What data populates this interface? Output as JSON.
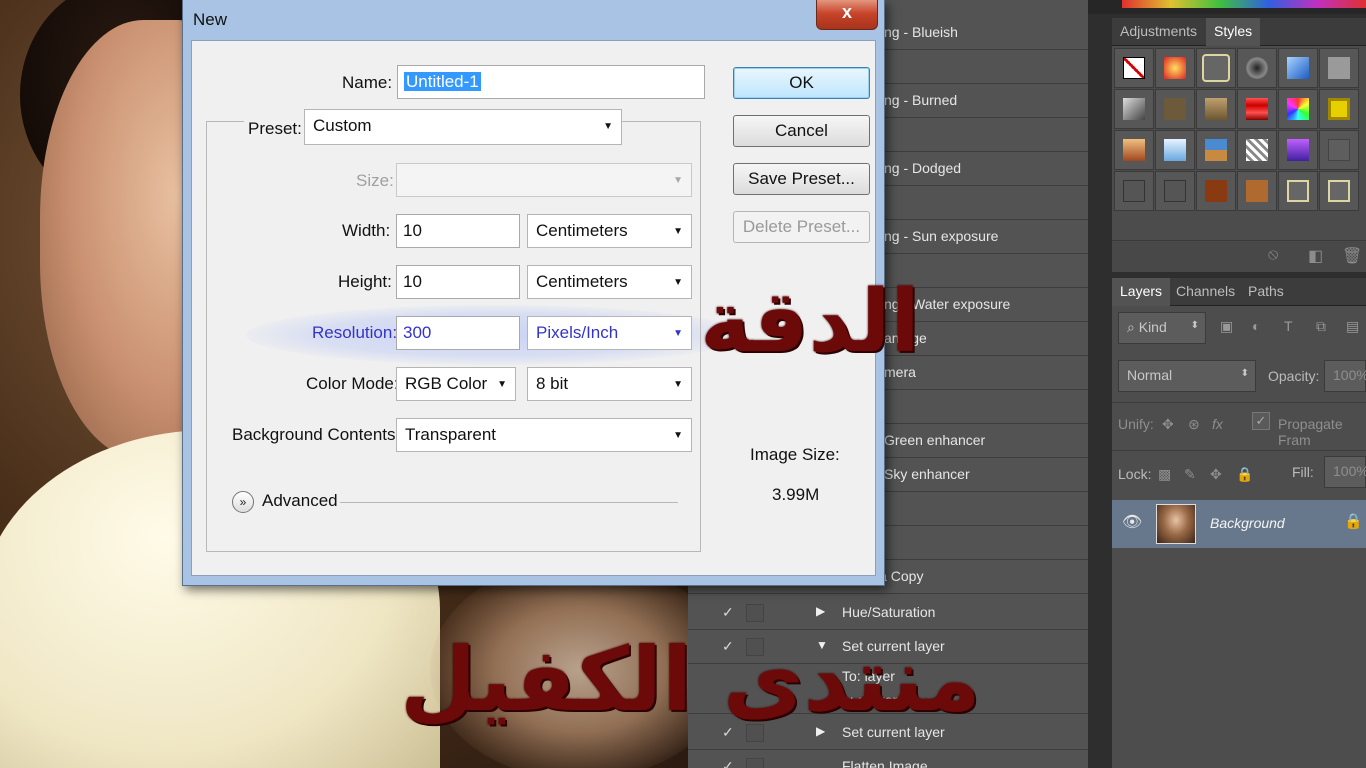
{
  "dialog": {
    "title": "New",
    "close_glyph": "x",
    "name_label": "Name:",
    "name_value": "Untitled-1",
    "preset_label": "Preset:",
    "preset_value": "Custom",
    "size_label": "Size:",
    "size_value": "",
    "width_label": "Width:",
    "width_value": "10",
    "width_unit": "Centimeters",
    "height_label": "Height:",
    "height_value": "10",
    "height_unit": "Centimeters",
    "resolution_label": "Resolution:",
    "resolution_value": "300",
    "resolution_unit": "Pixels/Inch",
    "color_mode_label": "Color Mode:",
    "color_mode_value": "RGB Color",
    "bit_depth_value": "8 bit",
    "background_label": "Background Contents:",
    "background_value": "Transparent",
    "advanced_label": "Advanced",
    "image_size_label": "Image Size:",
    "image_size_value": "3.99M",
    "buttons": {
      "ok": "OK",
      "cancel": "Cancel",
      "save_preset": "Save Preset...",
      "delete_preset": "Delete Preset..."
    }
  },
  "overlay": {
    "resolution_arabic": "الدقة",
    "forum_arabic": "منتدى الكفيل"
  },
  "actions": [
    {
      "label": "ng - Blueish"
    },
    {
      "label": ""
    },
    {
      "label": "ng - Burned"
    },
    {
      "label": ""
    },
    {
      "label": "ng - Dodged"
    },
    {
      "label": ""
    },
    {
      "label": "ng - Sun exposure"
    },
    {
      "label": ""
    },
    {
      "label": "ng - Water exposure"
    },
    {
      "label": "amage"
    },
    {
      "label": "mera"
    },
    {
      "label": ""
    },
    {
      "label": "Green enhancer"
    },
    {
      "label": "Sky enhancer"
    },
    {
      "label": ""
    },
    {
      "label": ""
    },
    {
      "label": "la Copy"
    },
    {
      "label": "Hue/Saturation"
    },
    {
      "label": "Set current layer"
    },
    {
      "label": "To: layer",
      "sub": "e: darken"
    },
    {
      "label": "Set current layer"
    },
    {
      "label": "Flatten Image"
    }
  ],
  "panels": {
    "adjustments_tab": "Adjustments",
    "styles_tab": "Styles",
    "layers_tab": "Layers",
    "channels_tab": "Channels",
    "paths_tab": "Paths",
    "kind_filter": "Kind",
    "blend_mode": "Normal",
    "opacity_label": "Opacity:",
    "opacity_value": "100%",
    "unify_label": "Unify:",
    "propagate_label": "Propagate Fram",
    "lock_label": "Lock:",
    "fill_label": "Fill:",
    "fill_value": "100%",
    "layer_name": "Background"
  },
  "colors": {
    "dialog_frame": "#a8c3e3",
    "resolution_text": "#3434c8",
    "overlay_text": "#6c0a0a",
    "selected_layer": "#67788c"
  }
}
